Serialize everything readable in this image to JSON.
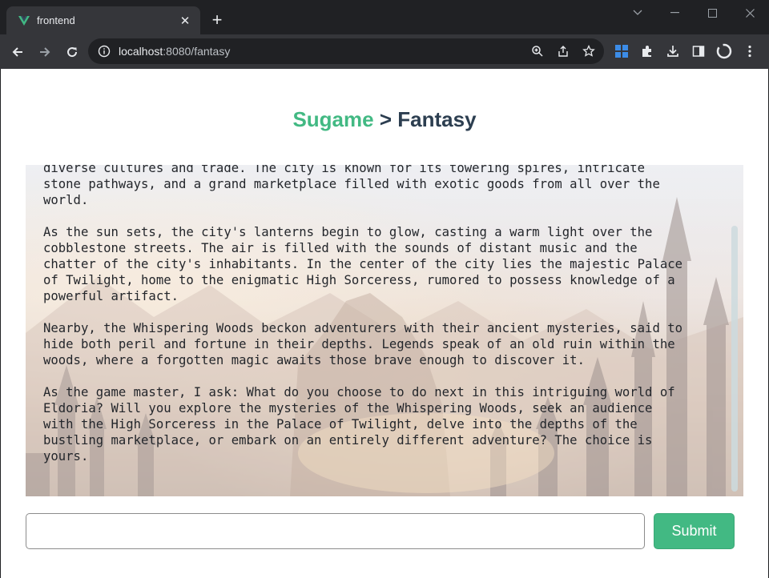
{
  "browser": {
    "tab_title": "frontend",
    "url_host": "localhost",
    "url_path": ":8080/fantasy"
  },
  "header": {
    "brand": "Sugame",
    "separator": ">",
    "section": "Fantasy"
  },
  "story": {
    "paragraphs": [
      "diverse cultures and trade. The city is known for its towering spires, intricate\nstone pathways, and a grand marketplace filled with exotic goods from all over the\nworld.",
      "As the sun sets, the city's lanterns begin to glow, casting a warm light over the\ncobblestone streets. The air is filled with the sounds of distant music and the\nchatter of the city's inhabitants. In the center of the city lies the majestic Palace\nof Twilight, home to the enigmatic High Sorceress, rumored to possess knowledge of a\npowerful artifact.",
      "Nearby, the Whispering Woods beckon adventurers with their ancient mysteries, said to\nhide both peril and fortune in their depths. Legends speak of an old ruin within the\nwoods, where a forgotten magic awaits those brave enough to discover it.",
      "As the game master, I ask: What do you choose to do next in this intriguing world of\nEldoria? Will you explore the mysteries of the Whispering Woods, seek an audience\nwith the High Sorceress in the Palace of Twilight, delve into the depths of the\nbustling marketplace, or embark on an entirely different adventure? The choice is\nyours."
    ]
  },
  "input": {
    "value": "",
    "placeholder": ""
  },
  "submit_label": "Submit",
  "colors": {
    "brand": "#42b983",
    "title": "#2c3e50"
  }
}
